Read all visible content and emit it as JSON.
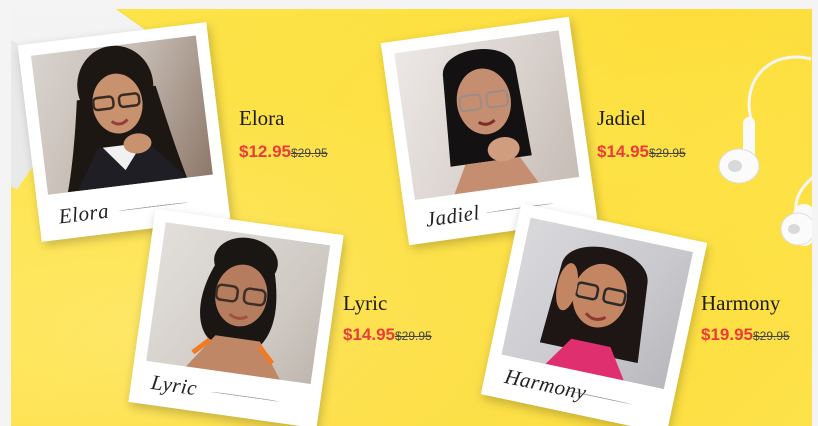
{
  "products": [
    {
      "name": "Elora",
      "signature": "Elora",
      "price": "$12.95",
      "original_price": "$29.95"
    },
    {
      "name": "Jadiel",
      "signature": "Jadiel",
      "price": "$14.95",
      "original_price": "$29.95"
    },
    {
      "name": "Lyric",
      "signature": "Lyric",
      "price": "$14.95",
      "original_price": "$29.95"
    },
    {
      "name": "Harmony",
      "signature": "Harmony",
      "price": "$19.95",
      "original_price": "$29.95"
    }
  ],
  "colors": {
    "background": "#fde34a",
    "sale_price": "#ec3b3b",
    "original_price": "#444444"
  }
}
